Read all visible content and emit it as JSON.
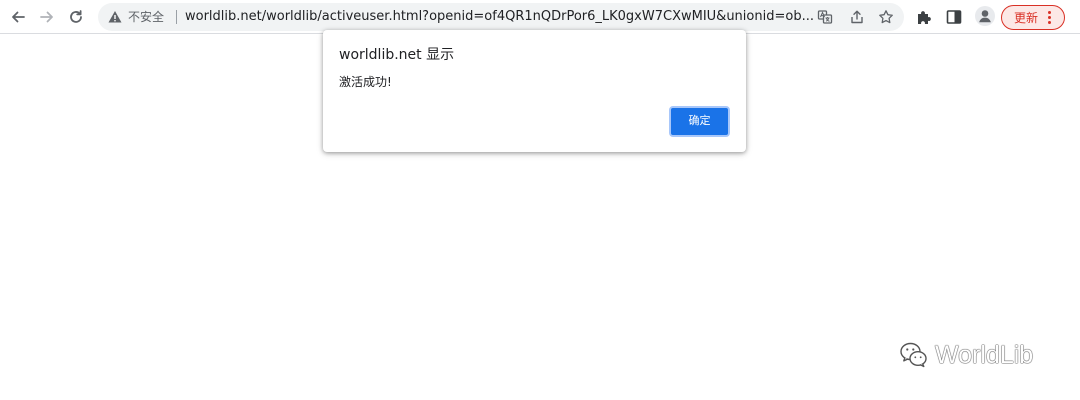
{
  "browser": {
    "security_label": "不安全",
    "url": "worldlib.net/worldlib/activeuser.html?openid=of4QR1nQDrPor6_LK0gxW7CXwMIU&unionid=ob...",
    "update_label": "更新"
  },
  "dialog": {
    "title": "worldlib.net 显示",
    "message": "激活成功!",
    "ok_label": "确定"
  },
  "watermark": {
    "text": "WorldLib"
  },
  "colors": {
    "accent": "#1a73e8",
    "update": "#d93025"
  }
}
